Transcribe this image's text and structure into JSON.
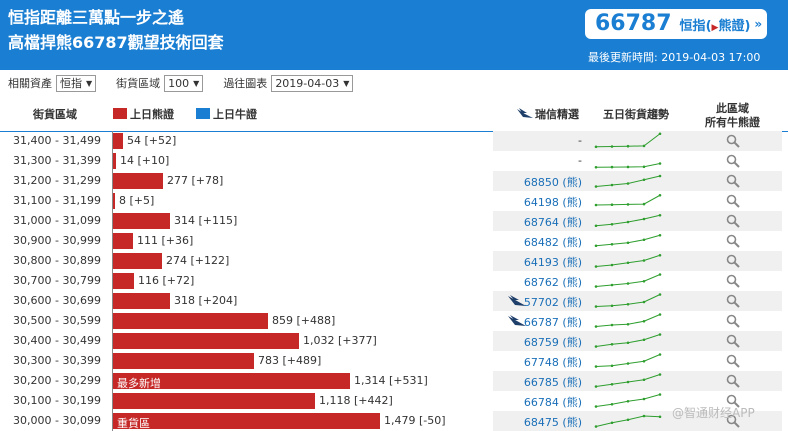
{
  "header": {
    "title_line1": "恒指距離三萬點一步之遙",
    "title_line2": "高檔捍熊66787觀望技術回套",
    "index_value": "66787",
    "index_name": "恒指",
    "index_tag": "熊證",
    "more": "»",
    "updated": "最後更新時間: 2019-04-03 17:00"
  },
  "filters": {
    "asset_label": "相關資產",
    "asset_value": "恒指",
    "range_label": "街貨區域",
    "range_value": "100",
    "chart_label": "過往圖表",
    "chart_value": "2019-04-03"
  },
  "columns": {
    "range": "街貨區域",
    "bear": "上日熊證",
    "bull": "上日牛證",
    "ubs": "瑞信精選",
    "trend": "五日街貨趨勢",
    "region_line1": "此區域",
    "region_line2": "所有牛熊證"
  },
  "colors": {
    "bear": "#c62828",
    "bull": "#1a7ed2",
    "trend": "#2e9e2e",
    "stripe": "#f0f0f0"
  },
  "icons": {
    "ubs": "ubs-logo-icon",
    "search": "magnifier-icon"
  },
  "chart_data": {
    "type": "bar",
    "orientation": "horizontal",
    "rows": [
      {
        "range": "31,400 - 31,499",
        "value": 54,
        "change": "+52",
        "ubs": false,
        "price": "-",
        "note": ""
      },
      {
        "range": "31,300 - 31,399",
        "value": 14,
        "change": "+10",
        "ubs": false,
        "price": "-",
        "note": ""
      },
      {
        "range": "31,200 - 31,299",
        "value": 277,
        "change": "+78",
        "ubs": false,
        "price": "68850 (熊)",
        "note": ""
      },
      {
        "range": "31,100 - 31,199",
        "value": 8,
        "change": "+5",
        "ubs": false,
        "price": "64198 (熊)",
        "note": ""
      },
      {
        "range": "31,000 - 31,099",
        "value": 314,
        "change": "+115",
        "ubs": false,
        "price": "68764 (熊)",
        "note": ""
      },
      {
        "range": "30,900 - 30,999",
        "value": 111,
        "change": "+36",
        "ubs": false,
        "price": "68482 (熊)",
        "note": ""
      },
      {
        "range": "30,800 - 30,899",
        "value": 274,
        "change": "+122",
        "ubs": false,
        "price": "64193 (熊)",
        "note": ""
      },
      {
        "range": "30,700 - 30,799",
        "value": 116,
        "change": "+72",
        "ubs": false,
        "price": "68762 (熊)",
        "note": ""
      },
      {
        "range": "30,600 - 30,699",
        "value": 318,
        "change": "+204",
        "ubs": true,
        "price": "57702 (熊)",
        "note": ""
      },
      {
        "range": "30,500 - 30,599",
        "value": 859,
        "change": "+488",
        "ubs": true,
        "price": "66787 (熊)",
        "note": ""
      },
      {
        "range": "30,400 - 30,499",
        "value": 1032,
        "change": "+377",
        "ubs": false,
        "price": "68759 (熊)",
        "note": ""
      },
      {
        "range": "30,300 - 30,399",
        "value": 783,
        "change": "+489",
        "ubs": false,
        "price": "67748 (熊)",
        "note": ""
      },
      {
        "range": "30,200 - 30,299",
        "value": 1314,
        "change": "+531",
        "ubs": false,
        "price": "66785 (熊)",
        "note": "最多新增"
      },
      {
        "range": "30,100 - 30,199",
        "value": 1118,
        "change": "+442",
        "ubs": false,
        "price": "66784 (熊)",
        "note": ""
      },
      {
        "range": "30,000 - 30,099",
        "value": 1479,
        "change": "-50",
        "ubs": false,
        "price": "68475 (熊)",
        "note": "重貨區"
      }
    ],
    "trends": [
      [
        0.08,
        0.1,
        0.12,
        0.14,
        0.95
      ],
      [
        0.05,
        0.06,
        0.07,
        0.08,
        0.3
      ],
      [
        0.1,
        0.2,
        0.3,
        0.55,
        0.8
      ],
      [
        0.2,
        0.22,
        0.24,
        0.26,
        0.85
      ],
      [
        0.15,
        0.25,
        0.4,
        0.6,
        0.85
      ],
      [
        0.15,
        0.25,
        0.35,
        0.55,
        0.85
      ],
      [
        0.1,
        0.2,
        0.35,
        0.5,
        0.85
      ],
      [
        0.1,
        0.2,
        0.3,
        0.45,
        0.9
      ],
      [
        0.1,
        0.15,
        0.25,
        0.4,
        0.9
      ],
      [
        0.1,
        0.2,
        0.25,
        0.45,
        0.9
      ],
      [
        0.1,
        0.25,
        0.35,
        0.55,
        0.9
      ],
      [
        0.1,
        0.15,
        0.3,
        0.45,
        0.9
      ],
      [
        0.1,
        0.25,
        0.4,
        0.55,
        0.9
      ],
      [
        0.1,
        0.25,
        0.45,
        0.6,
        0.9
      ],
      [
        0.1,
        0.35,
        0.55,
        0.8,
        0.75
      ]
    ]
  },
  "watermark": "@智通财经APP"
}
